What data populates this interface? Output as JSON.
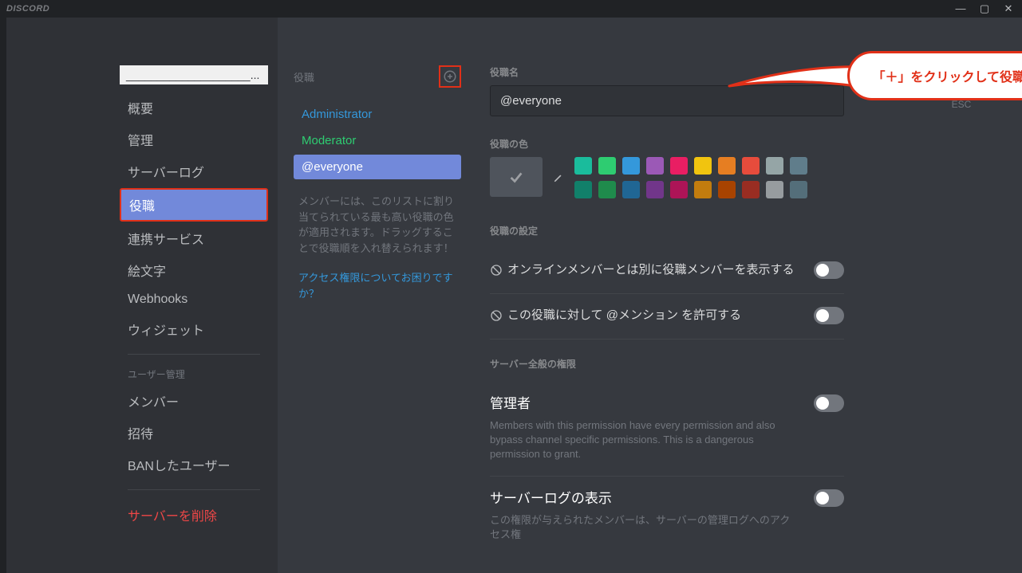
{
  "app": {
    "name": "DISCORD",
    "esc_label": "ESC"
  },
  "sidebar": {
    "server_name": "____________________...",
    "items": [
      {
        "label": "概要"
      },
      {
        "label": "管理"
      },
      {
        "label": "サーバーログ"
      },
      {
        "label": "役職",
        "active": true
      },
      {
        "label": "連携サービス"
      },
      {
        "label": "絵文字"
      },
      {
        "label": "Webhooks"
      },
      {
        "label": "ウィジェット"
      }
    ],
    "user_heading": "ユーザー管理",
    "user_items": [
      {
        "label": "メンバー"
      },
      {
        "label": "招待"
      },
      {
        "label": "BANしたユーザー"
      }
    ],
    "delete": "サーバーを削除"
  },
  "roles": {
    "heading": "役職",
    "list": [
      {
        "name": "Administrator",
        "cls": "role-admin"
      },
      {
        "name": "Moderator",
        "cls": "role-mod"
      },
      {
        "name": "@everyone",
        "cls": "role-everyone"
      }
    ],
    "desc": "メンバーには、このリストに割り当てられている最も高い役職の色が適用されます。ドラッグすることで役職順を入れ替えられます！",
    "help": "アクセス権限についてお困りですか？"
  },
  "settings": {
    "name_label": "役職名",
    "name_value": "@everyone",
    "color_label": "役職の色",
    "colors_row1": [
      "#1abc9c",
      "#2ecc71",
      "#3498db",
      "#9b59b6",
      "#e91e63",
      "#f1c40f",
      "#e67e22",
      "#e74c3c",
      "#95a5a6",
      "#607d8b"
    ],
    "colors_row2": [
      "#11806a",
      "#1f8b4c",
      "#206694",
      "#71368a",
      "#ad1457",
      "#c27c0e",
      "#a84300",
      "#992d22",
      "#979c9f",
      "#546e7a"
    ],
    "settings_heading": "役職の設定",
    "perm_display": "オンラインメンバーとは別に役職メンバーを表示する",
    "perm_mention": "この役職に対して @メンション を許可する",
    "general_heading": "サーバー全般の権限",
    "perm_admin_title": "管理者",
    "perm_admin_desc": "Members with this permission have every permission and also bypass channel specific permissions. This is a dangerous permission to grant.",
    "perm_log_title": "サーバーログの表示",
    "perm_log_desc": "この権限が与えられたメンバーは、サーバーの管理ログへのアクセス権"
  },
  "callout": {
    "text": "「＋」をクリックして役職の追加が可能"
  }
}
